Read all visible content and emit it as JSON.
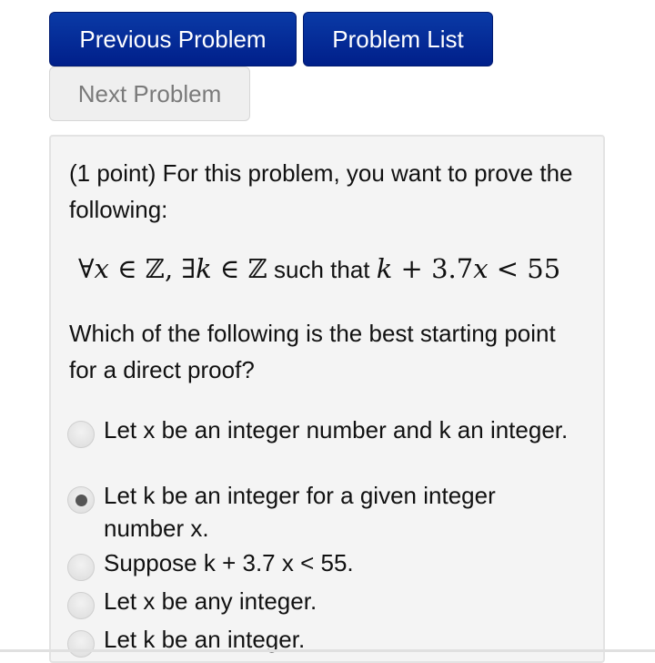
{
  "nav": {
    "previous_label": "Previous Problem",
    "list_label": "Problem List",
    "next_label": "Next Problem"
  },
  "problem": {
    "intro": "(1 point) For this problem, you want to prove the following:",
    "statement": {
      "forall": "∀",
      "x": "x",
      "in1": " ∈ ",
      "Z1": "ℤ",
      "comma": ", ",
      "exists": "∃",
      "k": "k",
      "in2": " ∈ ",
      "Z2": "ℤ",
      "such_that": " such that ",
      "k2": "k",
      "plus": " + 3.7",
      "x2": "x",
      "lt": " < 55"
    },
    "question": "Which of the following is the best starting point for a direct proof?",
    "options": [
      {
        "label": "Let x be an integer number and k an integer.",
        "selected": false
      },
      {
        "label": "Let k be an integer for a given integer number x.",
        "selected": true
      },
      {
        "label": "Suppose k + 3.7 x < 55.",
        "selected": false
      },
      {
        "label": "Let x be any integer.",
        "selected": false
      },
      {
        "label": "Let k be an integer.",
        "selected": false
      }
    ]
  }
}
